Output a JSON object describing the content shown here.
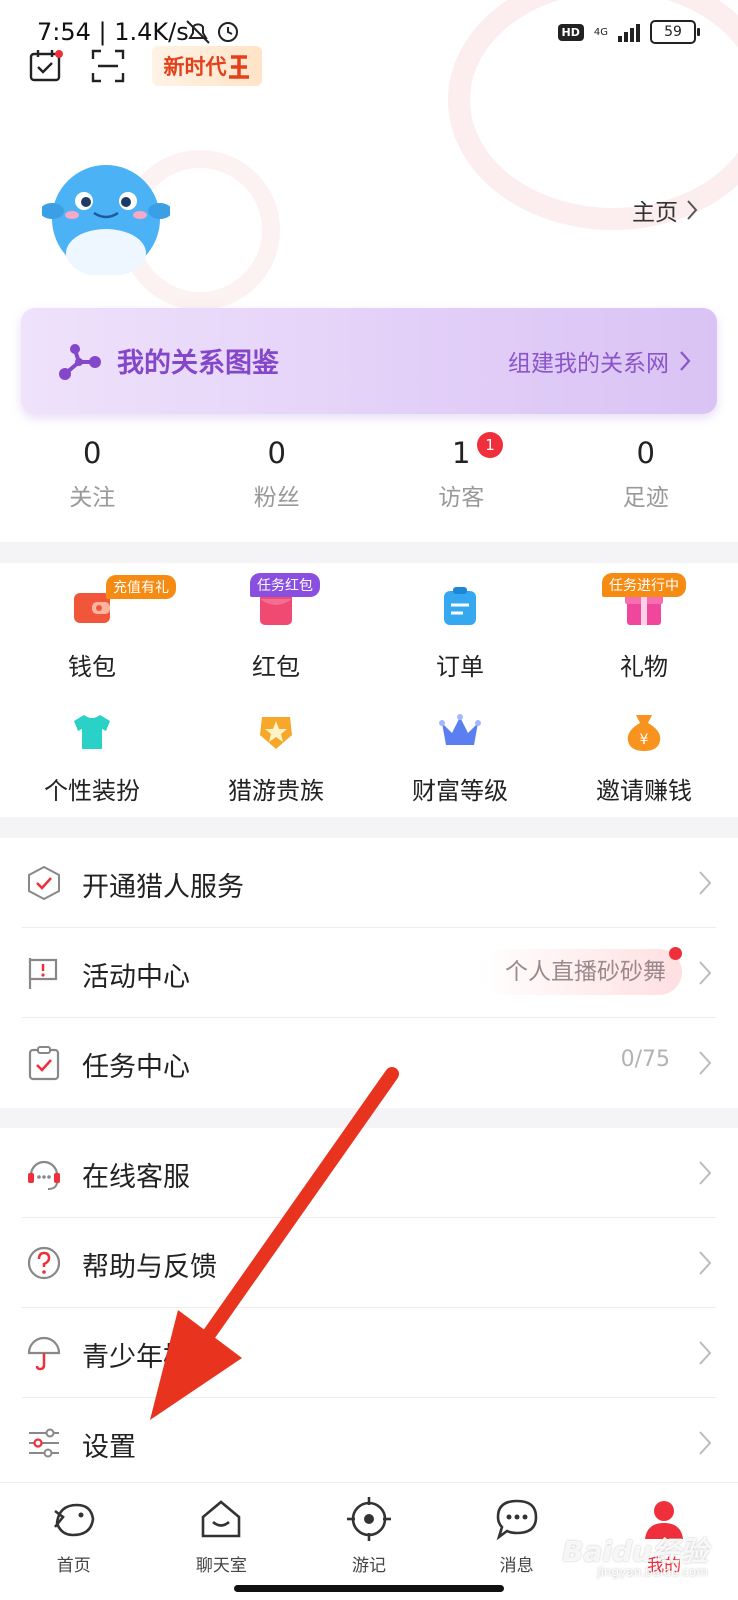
{
  "status_bar": {
    "time_speed": "7:54 | 1.4K/s",
    "hd": "HD",
    "network": "4G",
    "battery": "59"
  },
  "header": {
    "newera_label": "新时代"
  },
  "profile": {
    "home_link": "主页"
  },
  "relation_card": {
    "title": "我的关系图鉴",
    "action": "组建我的关系网"
  },
  "stats": [
    {
      "value": "0",
      "label": "关注"
    },
    {
      "value": "0",
      "label": "粉丝"
    },
    {
      "value": "1",
      "label": "访客",
      "badge": "1"
    },
    {
      "value": "0",
      "label": "足迹"
    }
  ],
  "grid": {
    "row1": [
      {
        "label": "钱包",
        "icon": "wallet-icon",
        "tag": "充值有礼",
        "tag_color": "#f58b12"
      },
      {
        "label": "红包",
        "icon": "red-envelope-icon",
        "tag": "任务红包",
        "tag_color": "#8b4fe0"
      },
      {
        "label": "订单",
        "icon": "order-icon"
      },
      {
        "label": "礼物",
        "icon": "gift-icon",
        "tag": "任务进行中",
        "tag_color": "#f58b12"
      }
    ],
    "row2": [
      {
        "label": "个性装扮",
        "icon": "tshirt-icon"
      },
      {
        "label": "猎游贵族",
        "icon": "noble-badge-icon"
      },
      {
        "label": "财富等级",
        "icon": "crown-icon"
      },
      {
        "label": "邀请赚钱",
        "icon": "money-bag-icon"
      }
    ]
  },
  "menu_group1": [
    {
      "label": "开通猎人服务",
      "icon": "shield-check-icon"
    },
    {
      "label": "活动中心",
      "icon": "flag-icon",
      "pill": "个人直播砂砂舞"
    },
    {
      "label": "任务中心",
      "icon": "clipboard-check-icon",
      "right": "0/75"
    }
  ],
  "menu_group2": [
    {
      "label": "在线客服",
      "icon": "headset-icon"
    },
    {
      "label": "帮助与反馈",
      "icon": "question-icon"
    },
    {
      "label": "青少年模式",
      "icon": "umbrella-icon"
    },
    {
      "label": "设置",
      "icon": "sliders-icon"
    }
  ],
  "bottom_nav": [
    {
      "label": "首页",
      "icon": "home-fish-icon"
    },
    {
      "label": "聊天室",
      "icon": "chatroom-house-icon"
    },
    {
      "label": "游记",
      "icon": "target-icon"
    },
    {
      "label": "消息",
      "icon": "message-bubble-icon"
    },
    {
      "label": "我的",
      "icon": "user-profile-icon",
      "active": true
    }
  ],
  "watermark": {
    "brand": "Baidu经验",
    "url": "jingyan.baidu.com"
  },
  "colors": {
    "accent": "#ef2f3c",
    "purple": "#8447c9",
    "arrow": "#e8331f"
  }
}
